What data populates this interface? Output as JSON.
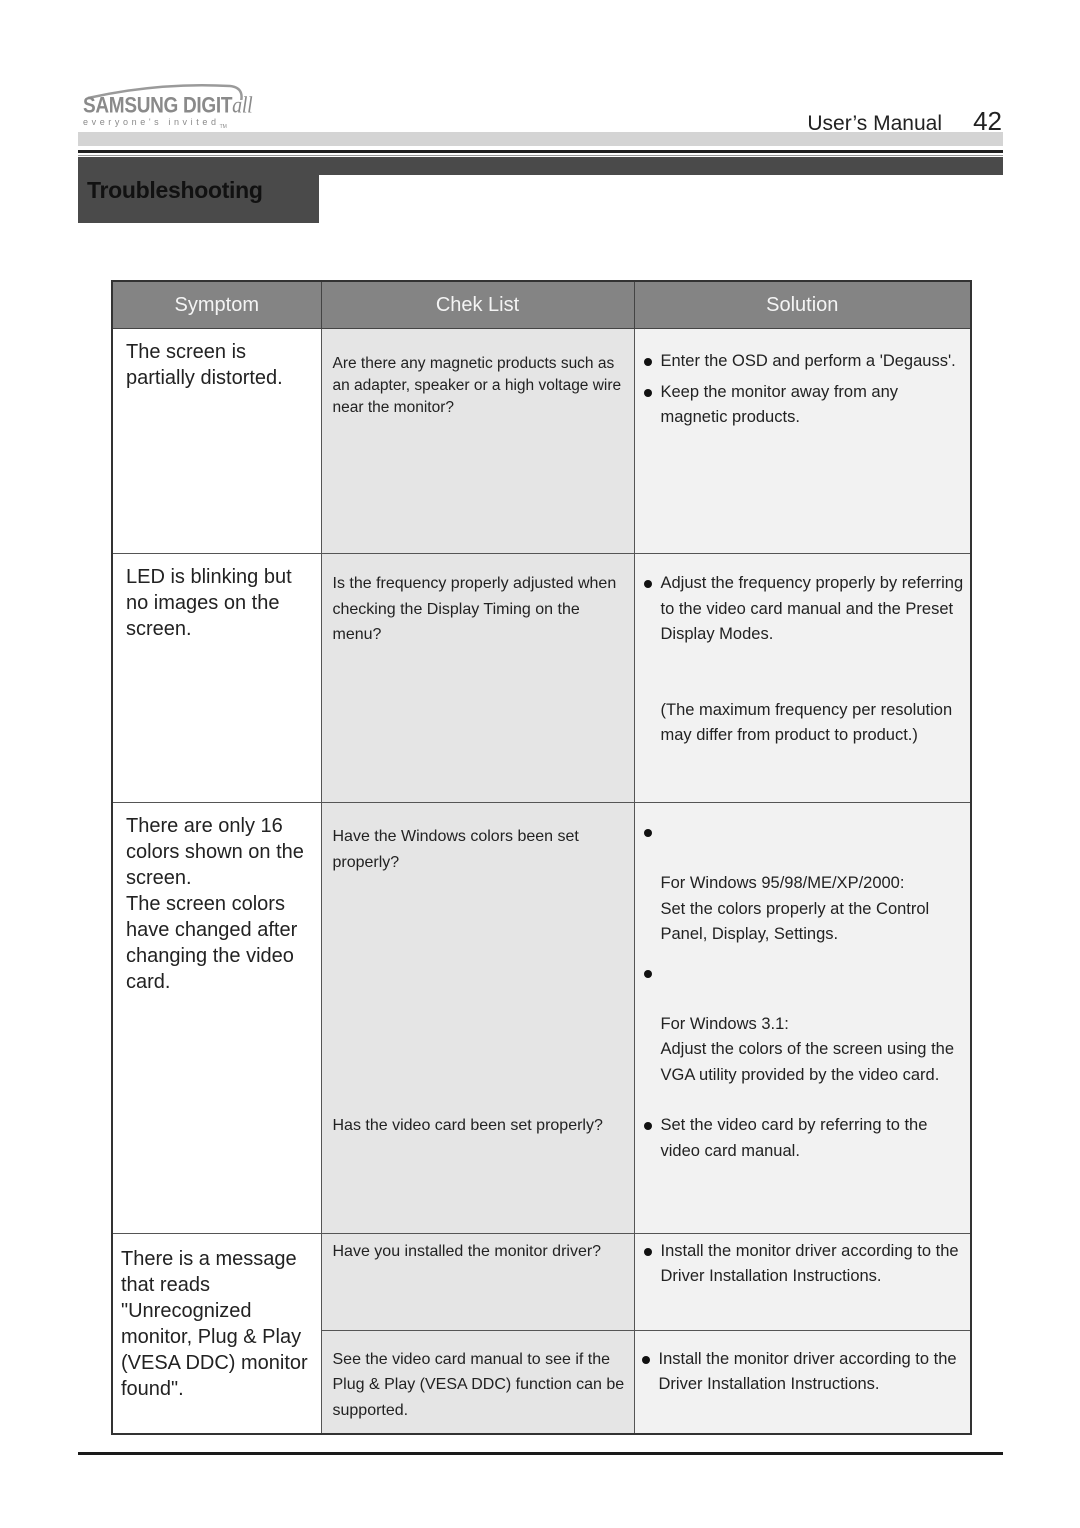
{
  "header": {
    "logo": {
      "brand": "SAMSUNG DIGIT",
      "brand_script": "all",
      "tagline": "everyone's invited",
      "tagline_mark": "TM"
    },
    "manual_title": "User’s  Manual",
    "page_number": "42"
  },
  "section": {
    "title": "Troubleshooting"
  },
  "table": {
    "columns": [
      "Symptom",
      "Chek List",
      "Solution"
    ],
    "rows": [
      {
        "symptom": "The screen is partially distorted.",
        "check": "Are there any magnetic products such as an adapter, speaker or a high voltage wire near the monitor?",
        "solutions": [
          "Enter the OSD and perform a 'Degauss'.",
          "Keep the monitor away from any magnetic products."
        ]
      },
      {
        "symptom": "LED is blinking but no images on the screen.",
        "check": "Is the frequency properly adjusted when checking the Display Timing on the menu?",
        "solutions": [
          "Adjust the frequency properly by referring to the video card manual and the Preset Display Modes."
        ],
        "note": "(The maximum frequency per resolution may differ from product to product.)"
      },
      {
        "symptom": "There are only 16 colors shown on the screen.\nThe screen colors have changed after changing the video card.",
        "checks": [
          {
            "check": "Have the Windows colors been set properly?",
            "solutions": [
              "For Windows 95/98/ME/XP/2000:\nSet the colors properly at the Control Panel, Display, Settings.",
              "For Windows 3.1:\nAdjust the colors of the screen using the VGA utility provided by the video card."
            ]
          },
          {
            "check": "Has the video card been set properly?",
            "solutions": [
              "Set the video card by referring to the video card manual."
            ]
          }
        ]
      },
      {
        "symptom": "There is a message that reads \"Unrecognized monitor, Plug & Play (VESA DDC) monitor found\".",
        "checks": [
          {
            "check": "Have you installed the monitor driver?",
            "solutions": [
              "Install the monitor driver according to the Driver Installation Instructions."
            ]
          },
          {
            "check": "See the video card manual to see if the Plug & Play (VESA DDC) function can be supported.",
            "solutions": [
              "Install the monitor driver according to the Driver Installation Instructions."
            ]
          }
        ]
      }
    ]
  }
}
